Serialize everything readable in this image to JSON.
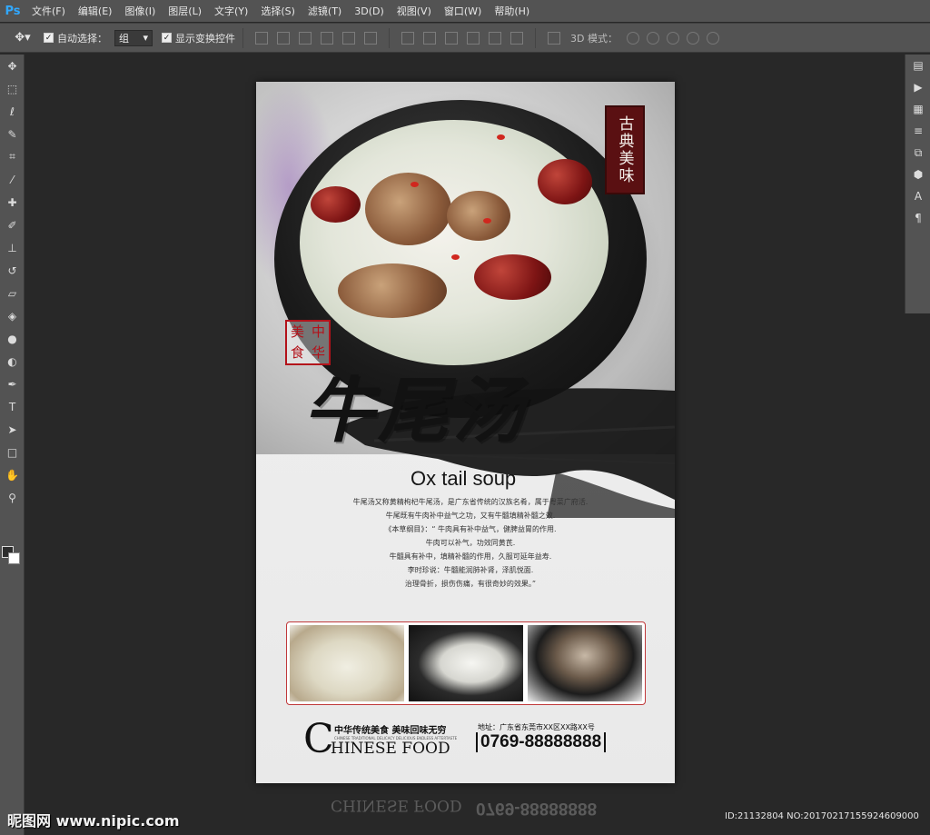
{
  "app": {
    "logo": "Ps",
    "menu": [
      "文件(F)",
      "编辑(E)",
      "图像(I)",
      "图层(L)",
      "文字(Y)",
      "选择(S)",
      "滤镜(T)",
      "3D(D)",
      "视图(V)",
      "窗口(W)",
      "帮助(H)"
    ]
  },
  "options_bar": {
    "auto_select_label": "自动选择：",
    "auto_select_value": "组",
    "show_transform_label": "显示变换控件",
    "mode_3d_label": "3D 模式："
  },
  "tools_left": [
    "move-icon",
    "marquee-icon",
    "lasso-icon",
    "quick-select-icon",
    "crop-icon",
    "eyedropper-icon",
    "healing-icon",
    "brush-icon",
    "stamp-icon",
    "history-brush-icon",
    "eraser-icon",
    "bucket-icon",
    "blur-icon",
    "dodge-icon",
    "pen-icon",
    "type-icon",
    "path-select-icon",
    "rectangle-icon",
    "hand-icon",
    "zoom-icon"
  ],
  "poster": {
    "seal_text": "古典美味",
    "stamp_chars": [
      "美",
      "中",
      "食",
      "华"
    ],
    "title_cn": "牛尾汤",
    "title_en": "Ox tail soup",
    "description": [
      "牛尾汤又称黄精枸杞牛尾汤，是广东省传统的汉族名肴，属于粤菜广府活.",
      "牛尾既有牛肉补中益气之功，又有牛髓填精补髓之效.",
      "《本草纲目》：“ 牛肉具有补中益气，健脾益胃的作用.",
      "牛肉可以补气，功效同黄芪.",
      "牛髓具有补中，填精补髓的作用，久服可延年益寿.",
      "李时珍说：牛髓能润肺补肾，泽肌悦面.",
      "治理骨折，损伤伤痛，有很奇妙的效果。”"
    ],
    "footer": {
      "big_c": "C",
      "slogan": "中华传统美食  美味回味无穷",
      "tiny": "CHINESE TRADITIONAL DELICACY DELICIOUS ENDLESS AFTERTASTE",
      "en": "HINESE FOOD",
      "address": "地址：广东省东莞市XX区XX路XX号",
      "phone": "0769-88888888"
    },
    "reflection_en": "CHINESE FOOD",
    "reflection_phone": "0769-88888888"
  },
  "watermark_left": "昵图网 www.nipic.com",
  "watermark_right": "ID:21132804 NO:20170217155924609000"
}
